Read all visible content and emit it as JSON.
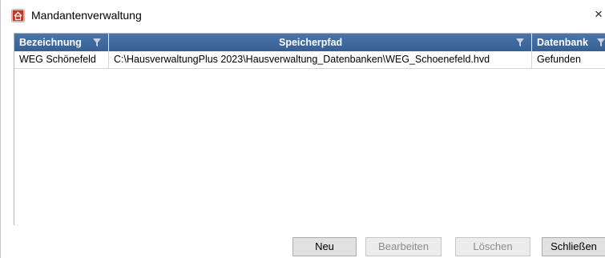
{
  "window": {
    "title": "Mandantenverwaltung",
    "close_glyph": "×"
  },
  "grid": {
    "columns": [
      {
        "label": "Bezeichnung"
      },
      {
        "label": "Speicherpfad"
      },
      {
        "label": "Datenbank"
      }
    ],
    "rows": [
      {
        "bezeichnung": "WEG Schönefeld",
        "speicherpfad": "C:\\HausverwaltungPlus 2023\\Hausverwaltung_Datenbanken\\WEG_Schoenefeld.hvd",
        "datenbank": "Gefunden"
      }
    ]
  },
  "buttons": {
    "new": "Neu",
    "edit": "Bearbeiten",
    "delete": "Löschen",
    "close": "Schließen"
  },
  "icons": {
    "app": "house-icon",
    "filter": "filter-icon",
    "close": "close-icon"
  },
  "colors": {
    "header_bg": "#3f6a9d",
    "app_icon": "#c0392b"
  }
}
